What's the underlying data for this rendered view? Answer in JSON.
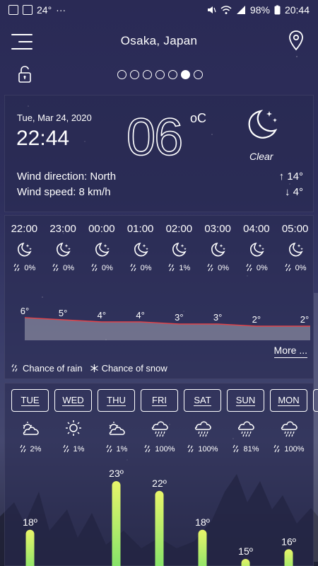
{
  "status_bar": {
    "temp": "24°",
    "dots": "···",
    "battery": "98%",
    "time": "20:44"
  },
  "header": {
    "location": "Osaka, Japan",
    "menu_icon": "hamburger-menu-icon",
    "pin_icon": "map-pin-icon",
    "lock_icon": "unlock-icon",
    "pages": 7,
    "active_page": 5
  },
  "current": {
    "date": "Tue, Mar 24, 2020",
    "time": "22:44",
    "temp": "06",
    "unit": "oC",
    "condition": "Clear",
    "wind_direction": "Wind direction: North",
    "wind_speed": "Wind speed: 8 km/h",
    "high": "↑ 14°",
    "low": "↓ 4°"
  },
  "hourly": {
    "items": [
      {
        "time": "22:00",
        "rain": "0%",
        "temp": 6,
        "temp_label": "6°"
      },
      {
        "time": "23:00",
        "rain": "0%",
        "temp": 5,
        "temp_label": "5°"
      },
      {
        "time": "00:00",
        "rain": "0%",
        "temp": 4,
        "temp_label": "4°"
      },
      {
        "time": "01:00",
        "rain": "0%",
        "temp": 4,
        "temp_label": "4°"
      },
      {
        "time": "02:00",
        "rain": "1%",
        "temp": 3,
        "temp_label": "3°"
      },
      {
        "time": "03:00",
        "rain": "0%",
        "temp": 3,
        "temp_label": "3°"
      },
      {
        "time": "04:00",
        "rain": "0%",
        "temp": 2,
        "temp_label": "2°"
      },
      {
        "time": "05:00",
        "rain": "0%",
        "temp": 2,
        "temp_label": "2°"
      }
    ],
    "more_label": "More ...",
    "legend_rain": "Chance of rain",
    "legend_snow": "Chance of snow",
    "line_color": "#e0444a"
  },
  "daily": {
    "days": [
      {
        "label": "TUE",
        "icon": "partly-cloudy-icon",
        "rain": "2%",
        "high": 18,
        "high_label": "18º"
      },
      {
        "label": "WED",
        "icon": "sun-icon",
        "rain": "1%",
        "high": null,
        "high_label": ""
      },
      {
        "label": "THU",
        "icon": "partly-cloudy-icon",
        "rain": "1%",
        "high": 23,
        "high_label": "23º"
      },
      {
        "label": "FRI",
        "icon": "rain-cloud-icon",
        "rain": "100%",
        "high": 22,
        "high_label": "22º"
      },
      {
        "label": "SAT",
        "icon": "rain-cloud-icon",
        "rain": "100%",
        "high": 18,
        "high_label": "18º"
      },
      {
        "label": "SUN",
        "icon": "rain-cloud-icon",
        "rain": "81%",
        "high": 15,
        "high_label": "15º"
      },
      {
        "label": "MON",
        "icon": "rain-cloud-icon",
        "rain": "100%",
        "high": 16,
        "high_label": "16º"
      }
    ],
    "bar_top_color": "#e8f56a",
    "bar_bottom_color": "#79e06a"
  }
}
